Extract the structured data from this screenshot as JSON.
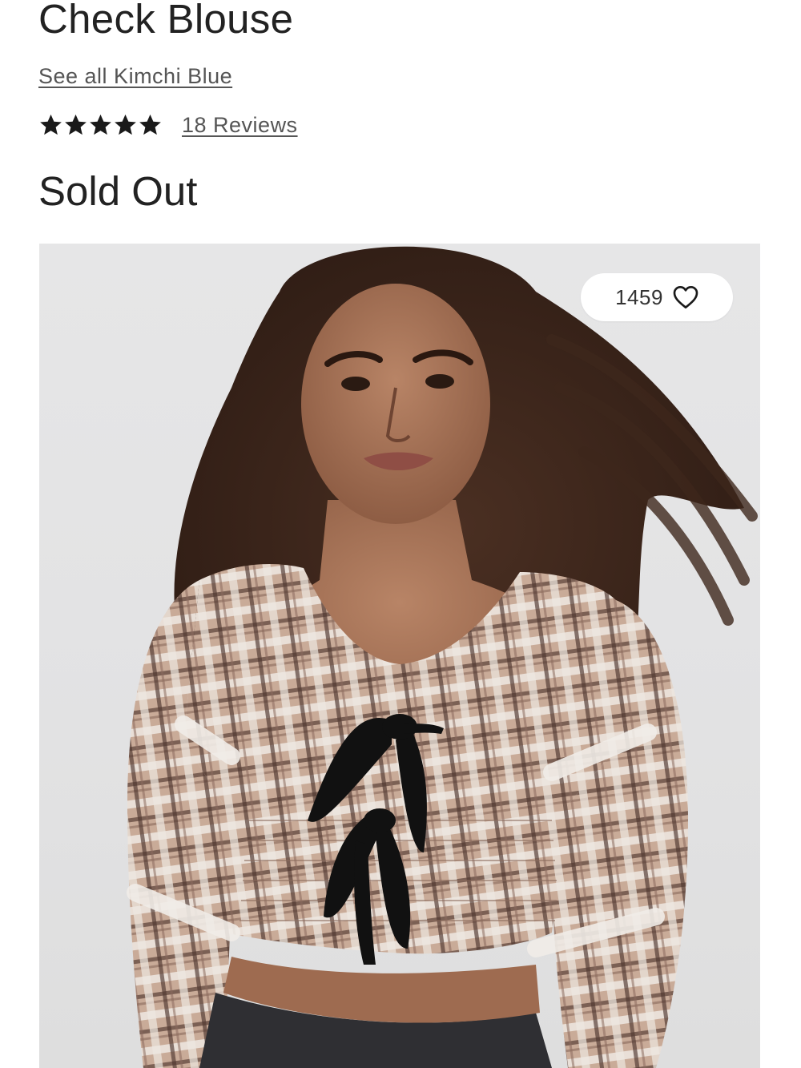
{
  "product": {
    "title": "Check Blouse",
    "brand_link": "See all Kimchi Blue",
    "rating": {
      "stars": 5,
      "max_stars": 5,
      "reviews_label": "18 Reviews"
    },
    "availability": "Sold Out",
    "image": {
      "description_icon": "product-photo",
      "like_count": "1459",
      "like_icon": "heart-outline-icon"
    }
  },
  "colors": {
    "text_primary": "#222222",
    "text_link": "#555555",
    "star": "#1a1a1a",
    "image_background": "#e4e4e5",
    "pill_background": "#ffffff"
  }
}
